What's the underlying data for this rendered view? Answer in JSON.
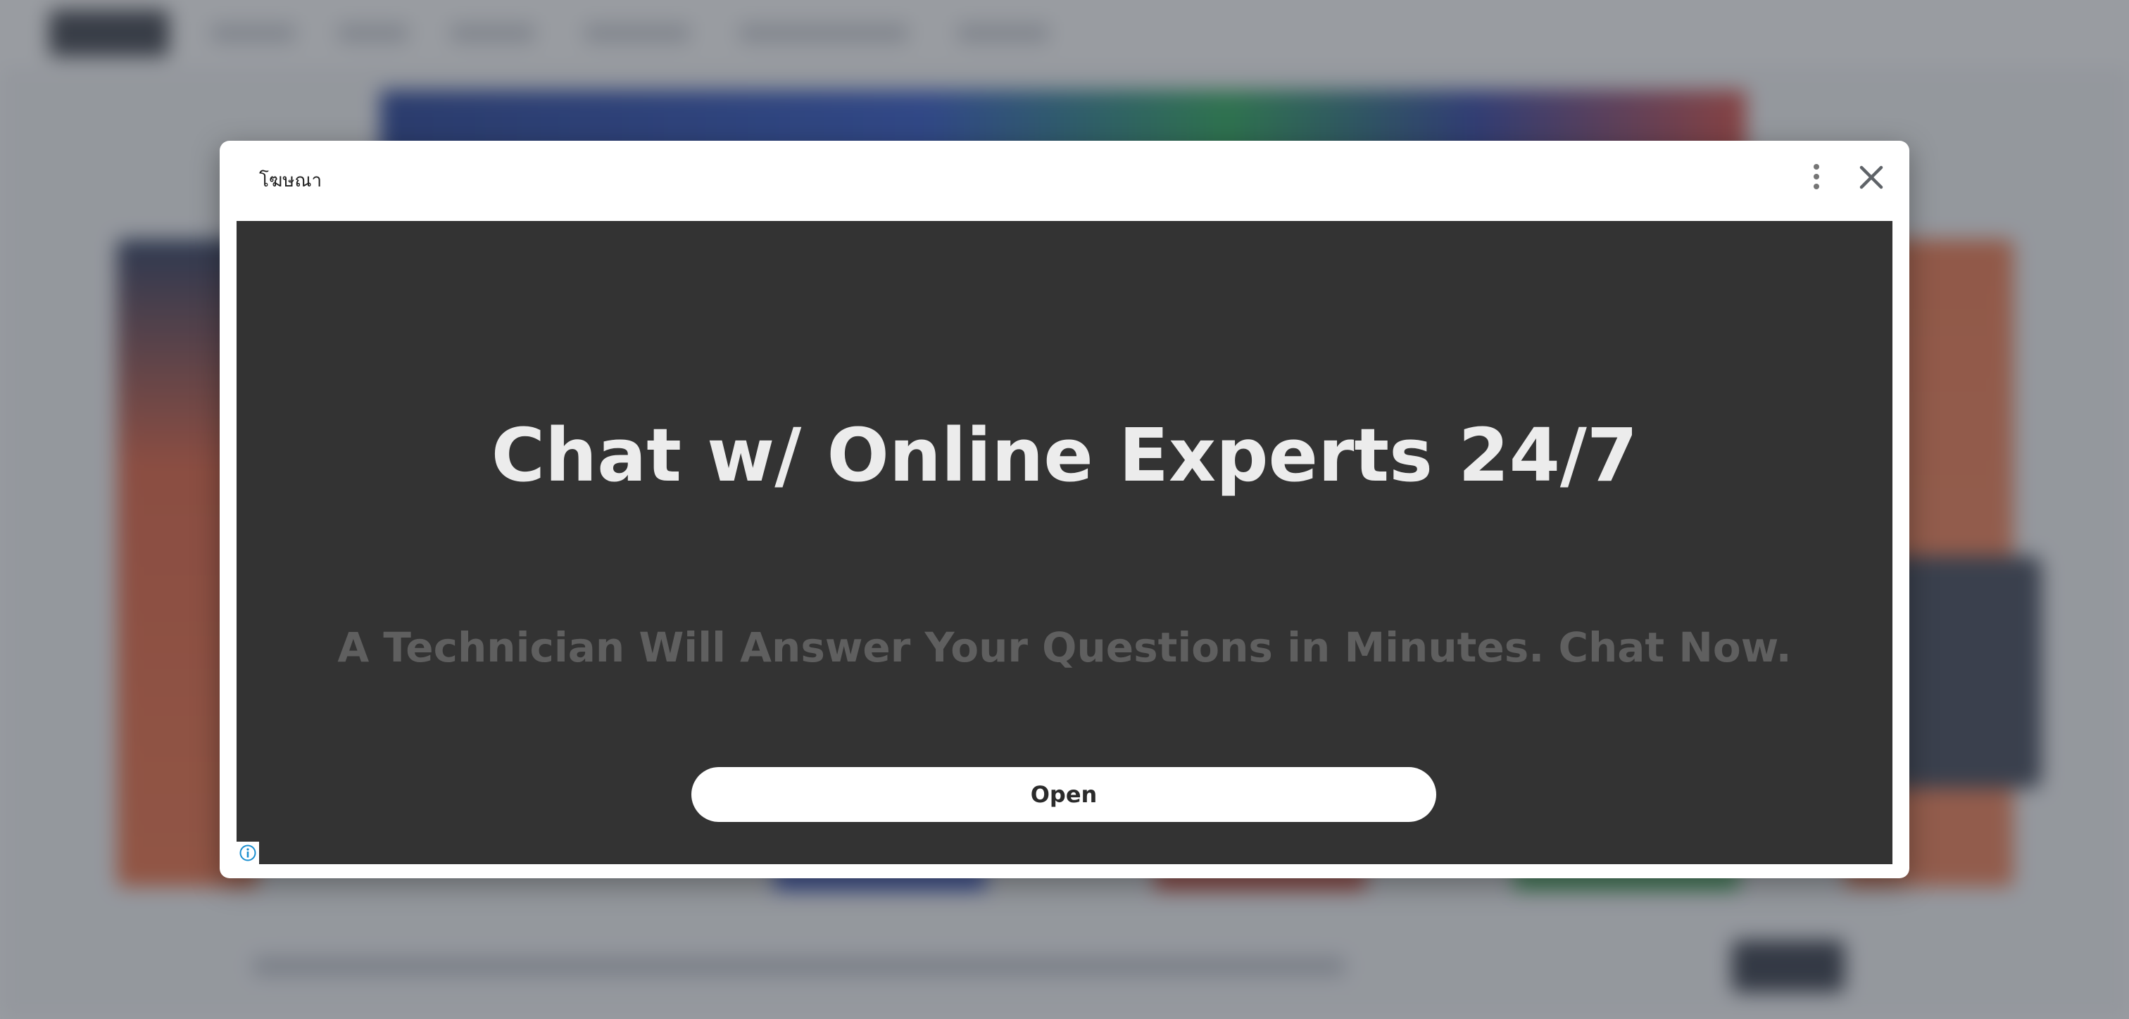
{
  "dialog": {
    "label": "โฆษณา",
    "more_icon": "more-vertical-icon",
    "close_icon": "close-icon"
  },
  "ad": {
    "headline": "Chat w/ Online Experts 24/7",
    "subhead": "A Technician Will Answer Your Questions in Minutes. Chat Now.",
    "cta_label": "Open",
    "adchoices_icon": "info-icon"
  },
  "colors": {
    "creative_bg": "#333333",
    "headline": "#ececec",
    "subhead": "#5f5f5f",
    "overlay": "#464a54"
  }
}
